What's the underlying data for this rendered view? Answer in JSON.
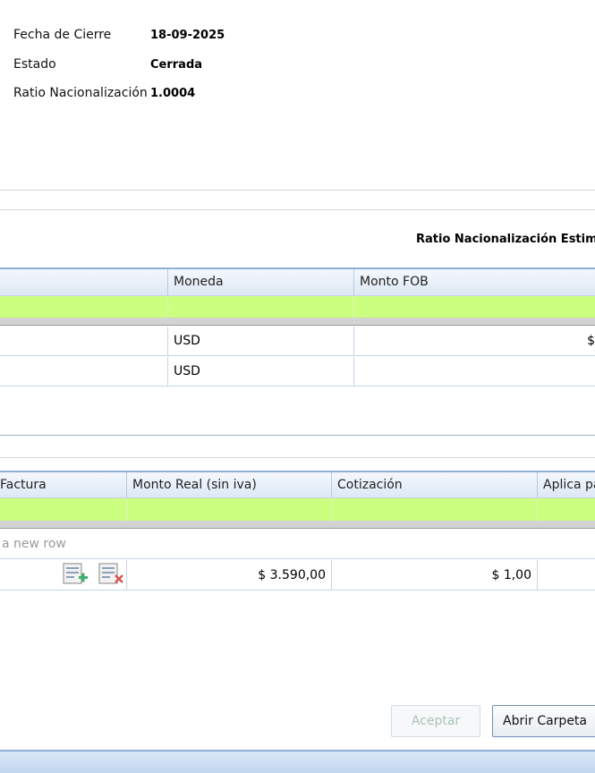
{
  "info": {
    "fecha_cierre_label": "Fecha de Cierre",
    "fecha_cierre_value": "18-09-2025",
    "estado_label": "Estado",
    "estado_value": "Cerrada",
    "ratio_label": "Ratio Nacionalización",
    "ratio_value": "1.0004"
  },
  "ratio_estimado_label": "Ratio Nacionalización Estimado",
  "grid1": {
    "columns": [
      "Moneda",
      "Monto FOB"
    ],
    "rows": [
      {
        "moneda": "USD",
        "monto_fob": "$"
      },
      {
        "moneda": "USD",
        "monto_fob": ""
      }
    ]
  },
  "grid2": {
    "columns": [
      "Factura",
      "Monto Real (sin iva)",
      "Cotización",
      "Aplica pa"
    ],
    "new_row_placeholder": "a new row",
    "rows": [
      {
        "monto_real": "$ 3.590,00",
        "cotizacion": "$ 1,00",
        "aplica": ""
      }
    ],
    "icons": [
      "add-row-icon",
      "delete-row-icon"
    ]
  },
  "buttons": {
    "aceptar": "Aceptar",
    "abrir_carpeta": "Abrir Carpeta"
  },
  "colors": {
    "filter_row": "#ccff80",
    "header_border": "#8fb0d6",
    "add_icon": "#3cb371",
    "delete_icon": "#d9534f"
  }
}
